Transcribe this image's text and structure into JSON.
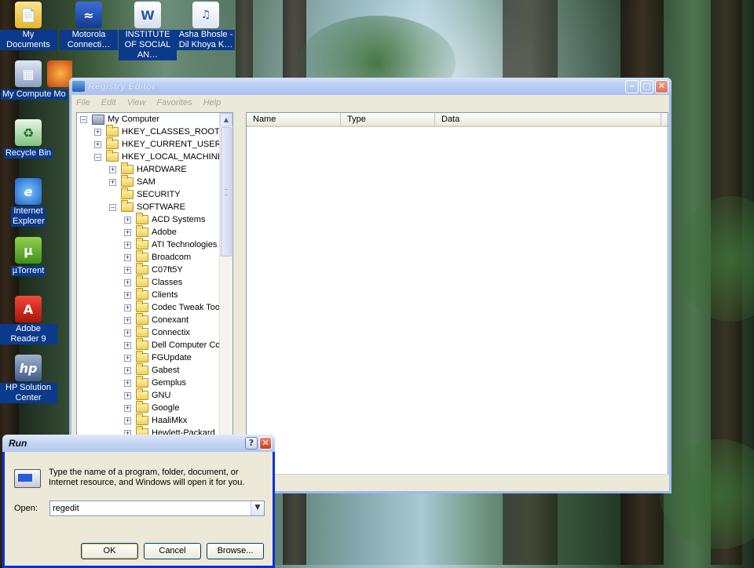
{
  "desktop": {
    "icons": [
      {
        "label": "My Documents"
      },
      {
        "label": "My Computer"
      },
      {
        "label": "Recycle Bin"
      },
      {
        "label": "Internet Explorer"
      },
      {
        "label": "µTorrent"
      },
      {
        "label": "Adobe Reader 9"
      },
      {
        "label": "HP Solution Center"
      },
      {
        "label": "Motorola Connecti…"
      },
      {
        "label": "INSTITUTE OF SOCIAL AN…"
      },
      {
        "label": "Asha Bhosle - Dil Khoya K…"
      },
      {
        "label": "Mo"
      }
    ]
  },
  "registry": {
    "title": "Registry Editor",
    "menu": [
      "File",
      "Edit",
      "View",
      "Favorites",
      "Help"
    ],
    "columns": [
      "Name",
      "Type",
      "Data"
    ],
    "root": "My Computer",
    "tree": [
      {
        "label": "HKEY_CLASSES_ROOT",
        "level": 1,
        "state": "+"
      },
      {
        "label": "HKEY_CURRENT_USER",
        "level": 1,
        "state": "+"
      },
      {
        "label": "HKEY_LOCAL_MACHINE",
        "level": 1,
        "state": "-"
      },
      {
        "label": "HARDWARE",
        "level": 2,
        "state": "+"
      },
      {
        "label": "SAM",
        "level": 2,
        "state": "+"
      },
      {
        "label": "SECURITY",
        "level": 2,
        "state": ""
      },
      {
        "label": "SOFTWARE",
        "level": 2,
        "state": "-"
      },
      {
        "label": "ACD Systems",
        "level": 3,
        "state": "+"
      },
      {
        "label": "Adobe",
        "level": 3,
        "state": "+"
      },
      {
        "label": "ATI Technologies",
        "level": 3,
        "state": "+"
      },
      {
        "label": "Broadcom",
        "level": 3,
        "state": "+"
      },
      {
        "label": "C07ft5Y",
        "level": 3,
        "state": "+"
      },
      {
        "label": "Classes",
        "level": 3,
        "state": "+"
      },
      {
        "label": "Clients",
        "level": 3,
        "state": "+"
      },
      {
        "label": "Codec Tweak Tool",
        "level": 3,
        "state": "+"
      },
      {
        "label": "Conexant",
        "level": 3,
        "state": "+"
      },
      {
        "label": "Connectix",
        "level": 3,
        "state": "+"
      },
      {
        "label": "Dell Computer Corpo",
        "level": 3,
        "state": "+"
      },
      {
        "label": "FGUpdate",
        "level": 3,
        "state": "+"
      },
      {
        "label": "Gabest",
        "level": 3,
        "state": "+"
      },
      {
        "label": "Gemplus",
        "level": 3,
        "state": "+"
      },
      {
        "label": "GNU",
        "level": 3,
        "state": "+"
      },
      {
        "label": "Google",
        "level": 3,
        "state": "+"
      },
      {
        "label": "HaaliMkx",
        "level": 3,
        "state": "+"
      },
      {
        "label": "Hewlett-Packard",
        "level": 3,
        "state": "+"
      }
    ]
  },
  "run": {
    "title": "Run",
    "description": "Type the name of a program, folder, document, or Internet resource, and Windows will open it for you.",
    "open_label": "Open:",
    "open_value": "regedit",
    "ok": "OK",
    "cancel": "Cancel",
    "browse": "Browse..."
  }
}
